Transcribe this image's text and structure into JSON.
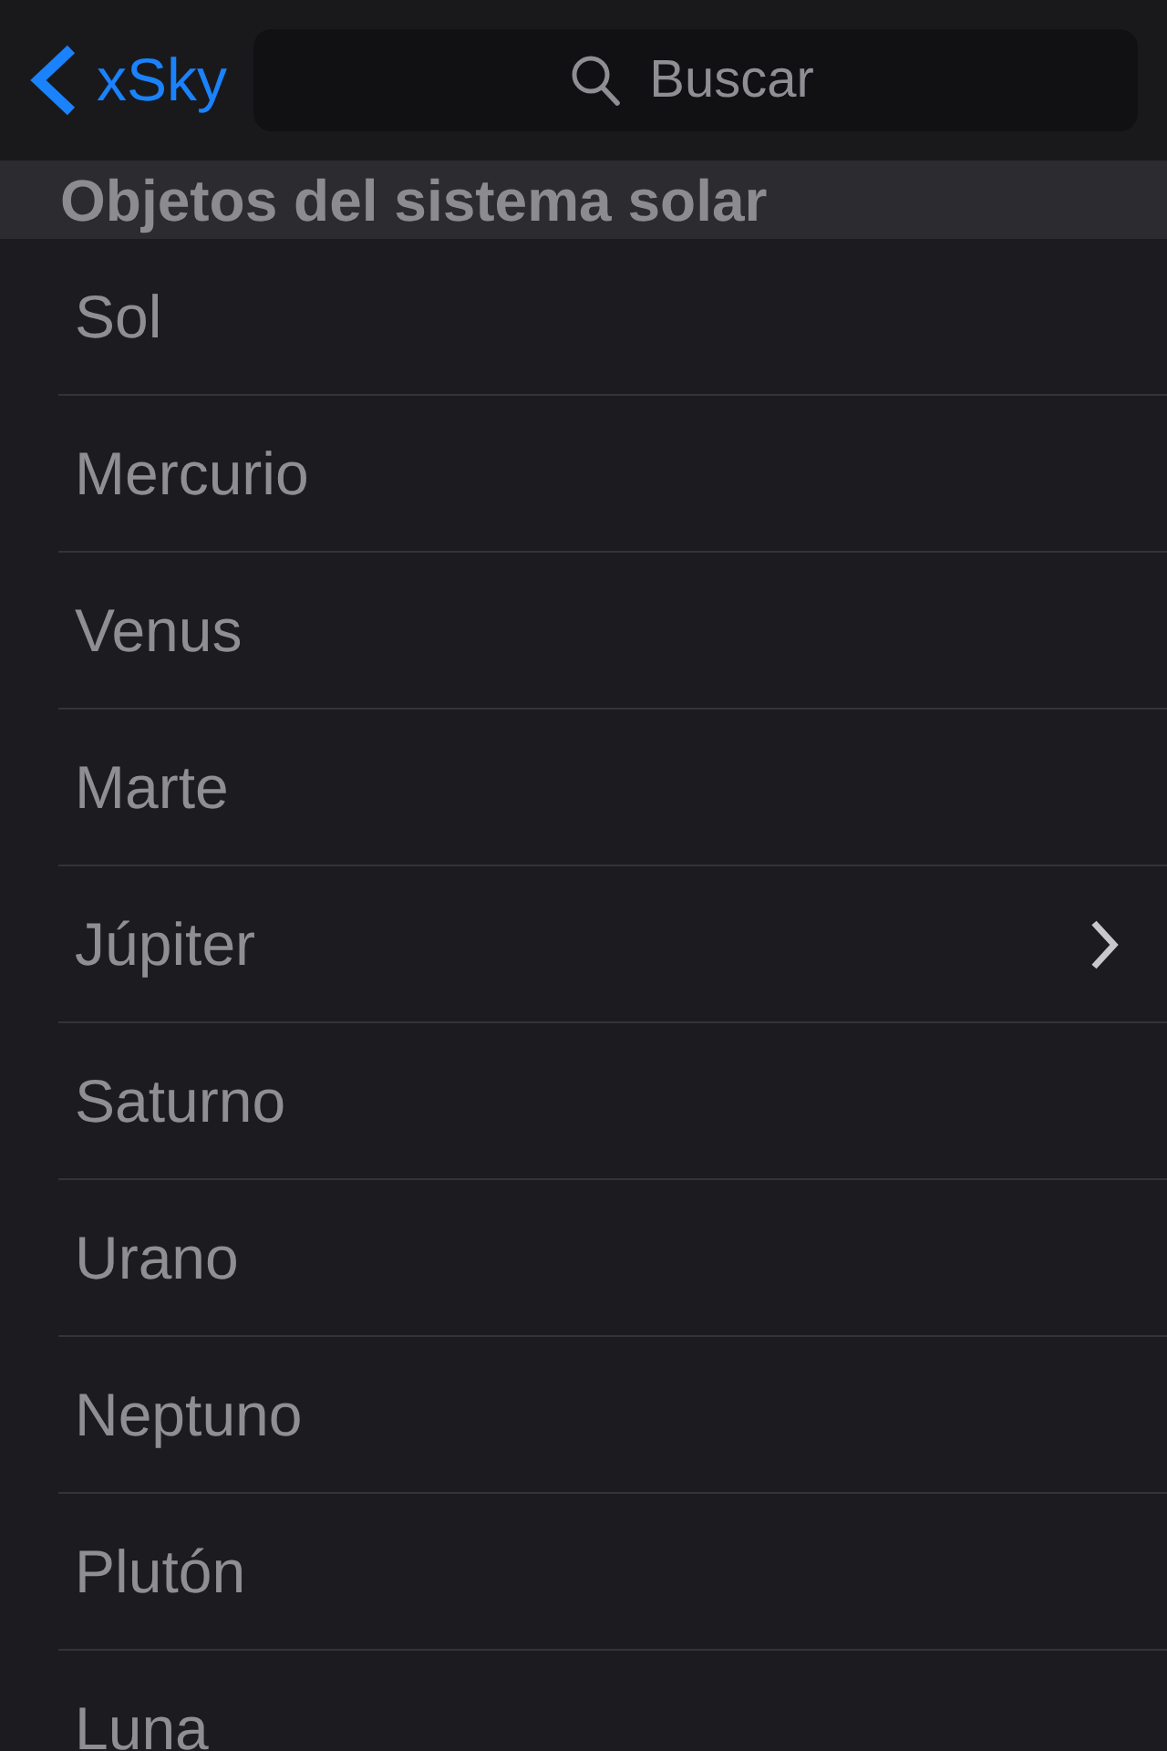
{
  "navigation_bar": {
    "back_button": {
      "label": "xSky"
    },
    "search": {
      "placeholder": "Buscar"
    }
  },
  "section": {
    "title": "Objetos del sistema solar",
    "items": [
      {
        "label": "Sol",
        "disclosure": false
      },
      {
        "label": "Mercurio",
        "disclosure": false
      },
      {
        "label": "Venus",
        "disclosure": false
      },
      {
        "label": "Marte",
        "disclosure": false
      },
      {
        "label": "Júpiter",
        "disclosure": true
      },
      {
        "label": "Saturno",
        "disclosure": false
      },
      {
        "label": "Urano",
        "disclosure": false
      },
      {
        "label": "Neptuno",
        "disclosure": false
      },
      {
        "label": "Plutón",
        "disclosure": false
      },
      {
        "label": "Luna",
        "disclosure": false
      }
    ]
  }
}
